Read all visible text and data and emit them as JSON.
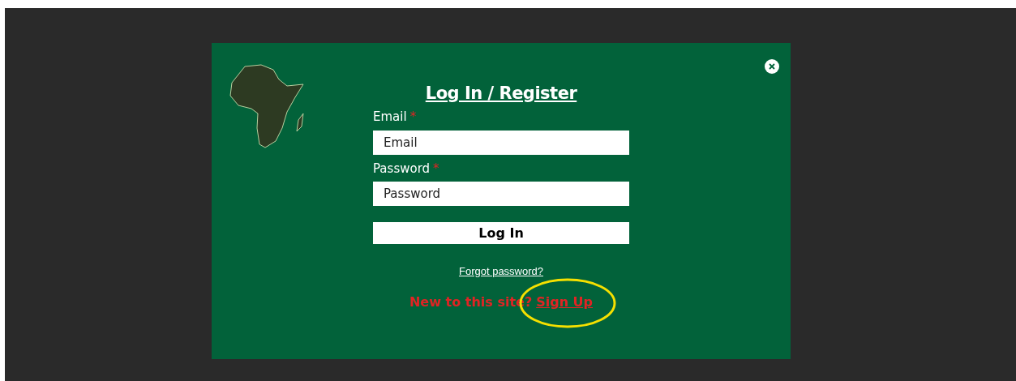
{
  "dialog": {
    "title": "Log In / Register",
    "fields": [
      {
        "label": "Email",
        "required_mark": "*",
        "placeholder": "Email"
      },
      {
        "label": "Password",
        "required_mark": "*",
        "placeholder": "Password"
      }
    ],
    "submit_button": "Log In",
    "forgot_link": "Forgot password?",
    "signup": {
      "prompt": "New to this site?",
      "link": "Sign Up"
    }
  }
}
